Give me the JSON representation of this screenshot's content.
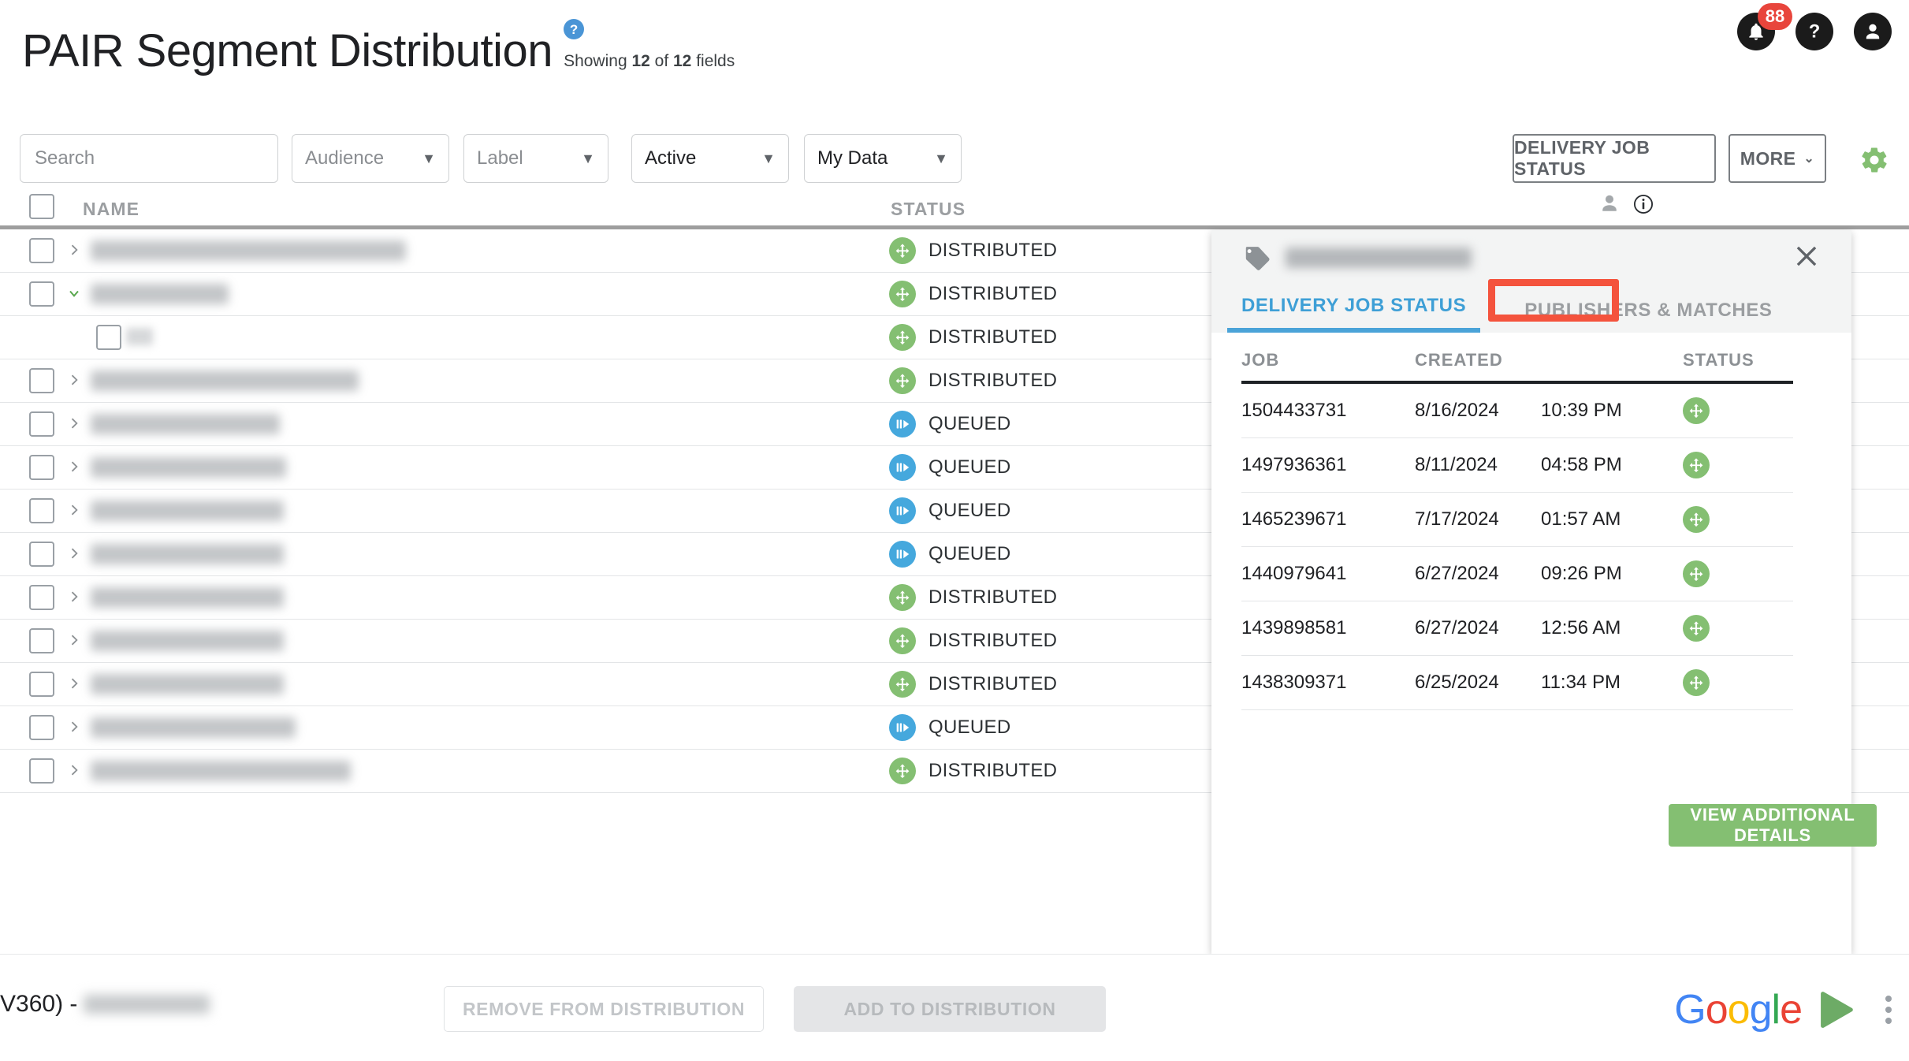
{
  "header": {
    "title": "PAIR Segment Distribution",
    "help_badge": "?",
    "showing_prefix": "Showing ",
    "showing_count": "12",
    "showing_mid": " of ",
    "showing_total": "12",
    "showing_suffix": " fields",
    "notification_count": "88",
    "icons": {
      "bell": "bell-icon",
      "help": "help-icon",
      "account": "account-icon"
    }
  },
  "toolbar": {
    "search_placeholder": "Search",
    "search_value": "",
    "filters": [
      {
        "name": "audience",
        "label": "Audience",
        "state": "placeholder"
      },
      {
        "name": "label",
        "label": "Label",
        "state": "placeholder"
      },
      {
        "name": "active",
        "label": "Active",
        "state": "selected"
      },
      {
        "name": "mydata",
        "label": "My Data",
        "state": "selected"
      }
    ],
    "delivery_job_status_label": "DELIVERY JOB STATUS",
    "more_label": "MORE",
    "gear_icon": "gear-icon",
    "gear_color": "#84bf72"
  },
  "table": {
    "columns": {
      "name": "NAME",
      "status": "STATUS"
    },
    "header_icons": {
      "person": "person-icon",
      "info": "info-icon"
    },
    "rows": [
      {
        "status": "DISTRIBUTED",
        "status_type": "distributed",
        "expanded": false,
        "name_width": 400,
        "indent": false
      },
      {
        "status": "DISTRIBUTED",
        "status_type": "distributed",
        "expanded": true,
        "name_width": 175,
        "indent": false
      },
      {
        "status": "DISTRIBUTED",
        "status_type": "distributed",
        "expanded": false,
        "name_width": 0,
        "indent": true
      },
      {
        "status": "DISTRIBUTED",
        "status_type": "distributed",
        "expanded": false,
        "name_width": 340,
        "indent": false
      },
      {
        "status": "QUEUED",
        "status_type": "queued",
        "expanded": false,
        "name_width": 240,
        "indent": false
      },
      {
        "status": "QUEUED",
        "status_type": "queued",
        "expanded": false,
        "name_width": 248,
        "indent": false
      },
      {
        "status": "QUEUED",
        "status_type": "queued",
        "expanded": false,
        "name_width": 245,
        "indent": false
      },
      {
        "status": "QUEUED",
        "status_type": "queued",
        "expanded": false,
        "name_width": 245,
        "indent": false
      },
      {
        "status": "DISTRIBUTED",
        "status_type": "distributed",
        "expanded": false,
        "name_width": 245,
        "indent": false
      },
      {
        "status": "DISTRIBUTED",
        "status_type": "distributed",
        "expanded": false,
        "name_width": 245,
        "indent": false
      },
      {
        "status": "DISTRIBUTED",
        "status_type": "distributed",
        "expanded": false,
        "name_width": 245,
        "indent": false
      },
      {
        "status": "QUEUED",
        "status_type": "queued",
        "expanded": false,
        "name_width": 260,
        "indent": false
      },
      {
        "status": "DISTRIBUTED",
        "status_type": "distributed",
        "expanded": false,
        "name_width": 330,
        "indent": false
      }
    ]
  },
  "panel": {
    "tag_icon": "tag-icon",
    "close_icon": "close-icon",
    "tabs": [
      {
        "name": "delivery-job-status",
        "label": "DELIVERY JOB STATUS",
        "active": true
      },
      {
        "name": "publishers-and-matches",
        "label": "PUBLISHERS & MATCHES",
        "active": false
      }
    ],
    "job_columns": {
      "job": "JOB",
      "created": "CREATED",
      "status": "STATUS"
    },
    "jobs": [
      {
        "job": "1504433731",
        "created": "8/16/2024",
        "time": "10:39 PM",
        "status_type": "distributed"
      },
      {
        "job": "1497936361",
        "created": "8/11/2024",
        "time": "04:58 PM",
        "status_type": "distributed"
      },
      {
        "job": "1465239671",
        "created": "7/17/2024",
        "time": "01:57 AM",
        "status_type": "distributed"
      },
      {
        "job": "1440979641",
        "created": "6/27/2024",
        "time": "09:26 PM",
        "status_type": "distributed"
      },
      {
        "job": "1439898581",
        "created": "6/27/2024",
        "time": "12:56 AM",
        "status_type": "distributed"
      },
      {
        "job": "1438309371",
        "created": "6/25/2024",
        "time": "11:34 PM",
        "status_type": "distributed"
      }
    ],
    "view_details_label": "VIEW ADDITIONAL DETAILS",
    "view_details_color": "#84bf72"
  },
  "annotation": {
    "target": "publishers-and-matches",
    "color": "#f4533d"
  },
  "bottom": {
    "left_text": "V360) -",
    "remove_label": "REMOVE FROM DISTRIBUTION",
    "add_label": "ADD TO DISTRIBUTION",
    "brand": {
      "word": "Google",
      "letters": [
        "G",
        "o",
        "o",
        "g",
        "l",
        "e"
      ],
      "colors": [
        "#4285F4",
        "#EA4335",
        "#FBBC05",
        "#4285F4",
        "#34A853",
        "#EA4335"
      ],
      "play_icon": "play-triangle-icon",
      "play_color": "#6dab66"
    },
    "kebab_icon": "kebab-menu-icon"
  },
  "status_colors": {
    "distributed": "#84bf72",
    "queued": "#45a8dd"
  }
}
